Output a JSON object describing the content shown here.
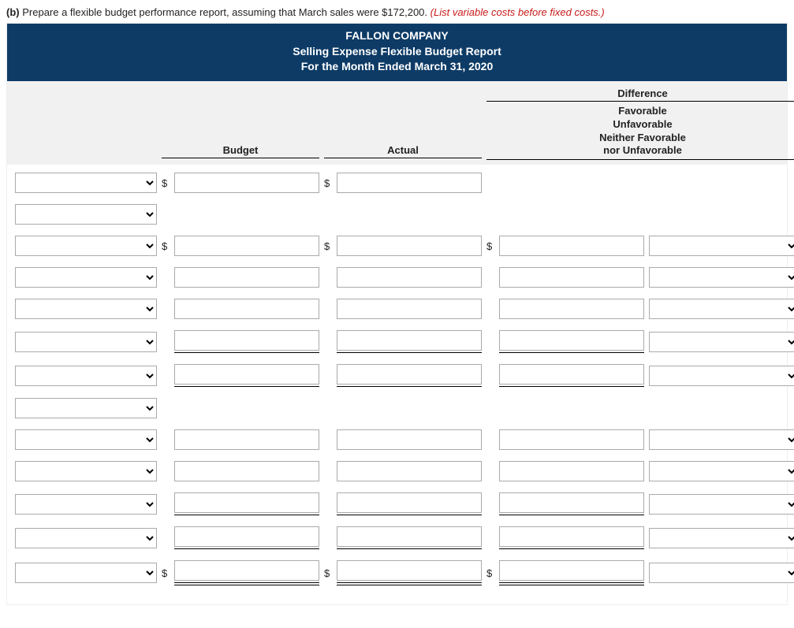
{
  "instruction": {
    "label": "(b)",
    "text": "Prepare a flexible budget performance report, assuming that March sales were $172,200.",
    "hint": "(List variable costs before fixed costs.)"
  },
  "title": {
    "line1": "FALLON COMPANY",
    "line2": "Selling Expense Flexible Budget Report",
    "line3": "For the Month Ended March 31, 2020"
  },
  "headers": {
    "budget": "Budget",
    "actual": "Actual",
    "difference": "Difference",
    "fav1": "Favorable",
    "fav2": "Unfavorable",
    "fav3": "Neither Favorable",
    "fav4": "nor Unfavorable"
  },
  "dollar": "$",
  "rows": [
    {
      "dropdown": true,
      "budget": "",
      "actual": "",
      "diff": null,
      "favsel": null,
      "dollars": true,
      "rule": "none"
    },
    {
      "dropdown": true,
      "budget": null,
      "actual": null,
      "diff": null,
      "favsel": null,
      "dollars": false,
      "rule": "none"
    },
    {
      "dropdown": true,
      "budget": "",
      "actual": "",
      "diff": "",
      "favsel": "",
      "dollars": true,
      "rule": "none"
    },
    {
      "dropdown": true,
      "budget": "",
      "actual": "",
      "diff": "",
      "favsel": "",
      "dollars": false,
      "rule": "none"
    },
    {
      "dropdown": true,
      "budget": "",
      "actual": "",
      "diff": "",
      "favsel": "",
      "dollars": false,
      "rule": "none"
    },
    {
      "dropdown": true,
      "budget": "",
      "actual": "",
      "diff": "",
      "favsel": "",
      "dollars": false,
      "rule": "single"
    },
    {
      "dropdown": true,
      "budget": "",
      "actual": "",
      "diff": "",
      "favsel": "",
      "dollars": false,
      "rule": "single-after"
    },
    {
      "dropdown": true,
      "budget": null,
      "actual": null,
      "diff": null,
      "favsel": null,
      "dollars": false,
      "rule": "none"
    },
    {
      "dropdown": true,
      "budget": "",
      "actual": "",
      "diff": "",
      "favsel": "",
      "dollars": false,
      "rule": "none"
    },
    {
      "dropdown": true,
      "budget": "",
      "actual": "",
      "diff": "",
      "favsel": "",
      "dollars": false,
      "rule": "none"
    },
    {
      "dropdown": true,
      "budget": "",
      "actual": "",
      "diff": "",
      "favsel": "",
      "dollars": false,
      "rule": "single"
    },
    {
      "dropdown": true,
      "budget": "",
      "actual": "",
      "diff": "",
      "favsel": "",
      "dollars": false,
      "rule": "single-after"
    },
    {
      "dropdown": true,
      "budget": "",
      "actual": "",
      "diff": "",
      "favsel": "",
      "dollars": true,
      "rule": "double-after"
    }
  ]
}
